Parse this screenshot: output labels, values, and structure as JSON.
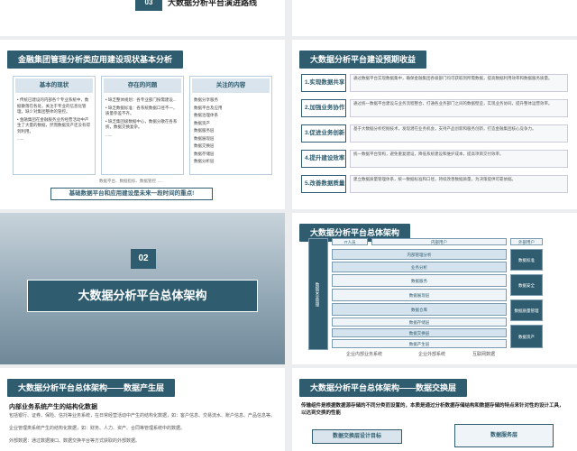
{
  "top_left": {
    "section_number": "03",
    "section_title": "大数据分析平台演进路线"
  },
  "slide_status": {
    "header": "金融集团管理分析类应用建设现状基本分析",
    "columns": [
      {
        "title": "基本的现状",
        "lines": [
          "• 传统已建设的内部各个专业系统中，数据散落在各处，关注于专业的信息化管理，缺少对集团整体的管控。",
          "• 金融集团在金融服务业务经营活动中产生了大量的数据，然而数据资产还没有得到利用。",
          "......"
        ]
      },
      {
        "title": "存在的问题",
        "lines": [
          "• 缺乏整体规划：各专业部门按需建设...",
          "• 缺乏数据标准：各系统数据口径不一，质量参差不齐。",
          "• 缺乏集团级数据中心，数据分散在各系统，数据交换复杂。",
          "......"
        ]
      },
      {
        "title": "关注的内容",
        "lines": [
          "数据分享服务",
          "数据平台及应用",
          "数据治理体系",
          "数据资产",
          "数据服务层",
          "数据展现层",
          "数据交换层",
          "数据存储层",
          "数据分析层",
          "......"
        ]
      }
    ],
    "footnote": "数据平台、数据指标、数据管控 ......",
    "banner": "基础数据平台和应用建设是未来一段时间的重点!"
  },
  "slide_benefits": {
    "header": "大数据分析平台建设预期收益",
    "rows": [
      {
        "label": "1.实现数据共享",
        "text": "通过数据平台实现数据集中，确保金融集团各级部门均可获取到所需数据，提高数据利用效率和数据服务质量。"
      },
      {
        "label": "2.加强业务协作",
        "text": "通过统一数据平台建设与业务流程整合，打通各业务部门之间的数据壁垒，实现业务协同，提升整体运营效率。"
      },
      {
        "label": "3.促进业务创新",
        "text": "基于大数据分析挖掘技术，发现潜在业务机会，支持产品创新和服务创新，打造金融集团核心竞争力。"
      },
      {
        "label": "4.提升建设效率",
        "text": "统一数据平台架构，避免重复建设，降低系统建设和维护成本，提高项目交付效率。"
      },
      {
        "label": "5.改善数据质量",
        "text": "建立数据质量管理体系，统一数据标准和口径，持续改善数据质量，为决策提供可靠依据。"
      }
    ]
  },
  "section_02": {
    "number": "02",
    "title": "大数据分析平台总体架构"
  },
  "slide_arch": {
    "header": "大数据分析平台总体架构",
    "top_labels": [
      "IT人员",
      "内部用户",
      "外部用户"
    ],
    "left_col": [
      "数据安全管理"
    ],
    "blocks": [
      "内部管理分析",
      "业务分析",
      "数据服务",
      "数据展现层",
      "数据仓库",
      "数据存储层",
      "数据交换层",
      "数据产生层"
    ],
    "right_col": [
      "数据标准",
      "数据安全",
      "数据质量管理",
      "数据资产"
    ],
    "bottom_labels": [
      "企业内部业务系统",
      "企业外部系统",
      "互联网数据"
    ]
  },
  "slide_produce": {
    "header": "大数据分析平台总体架构——数据产生层",
    "subtitle": "内部业务系统产生的结构化数据",
    "lines": [
      "包括银行、证券、保险、信托等业务系统，在日常经营活动中产生的结构化数据，如：客户信息、交易流水、账户信息、产品信息等。",
      "企业管理类系统产生的结构化数据，如：财务、人力、资产、合同等管理系统中的数据。",
      "外部数据：通过数据接口、数据交换平台等方式获取的外部数据。"
    ]
  },
  "slide_exchange": {
    "header": "大数据分析平台总体架构——数据交换层",
    "intro": "传输组件是根据数据源存储的不同分类而设置的，本质是通过分析数据存储结构和数据存储的特点来针对性的设计工具，以达到交换的性能",
    "left_box": "数据交换层设计目标",
    "right_box": "数据服务层"
  }
}
